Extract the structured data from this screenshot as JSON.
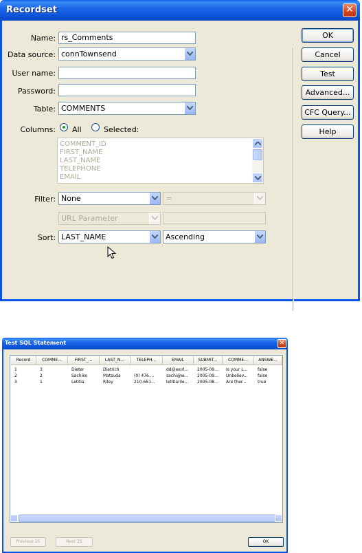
{
  "recordset": {
    "title": "Recordset",
    "fields": {
      "name_label": "Name:",
      "name_value": "rs_Comments",
      "datasource_label": "Data source:",
      "datasource_value": "connTownsend",
      "username_label": "User name:",
      "username_value": "",
      "password_label": "Password:",
      "password_value": "",
      "table_label": "Table:",
      "table_value": "COMMENTS",
      "columns_label": "Columns:",
      "columns_all": "All",
      "columns_selected": "Selected:",
      "columns_list": [
        "COMMENT_ID",
        "FIRST_NAME",
        "LAST_NAME",
        "TELEPHONE",
        "EMAIL"
      ],
      "filter_label": "Filter:",
      "filter_value": "None",
      "filter_operator": "=",
      "filter_param": "URL Parameter",
      "filter_param_value": "",
      "sort_label": "Sort:",
      "sort_value": "LAST_NAME",
      "sort_order": "Ascending"
    },
    "buttons": {
      "ok": "OK",
      "cancel": "Cancel",
      "test": "Test",
      "advanced": "Advanced...",
      "cfc_query": "CFC Query...",
      "help": "Help"
    }
  },
  "test_sql": {
    "title": "Test SQL Statement",
    "columns": [
      "Record",
      "COMME...",
      "FIRST_...",
      "LAST_N...",
      "TELEPH...",
      "EMAIL",
      "SUBMIT...",
      "COMME...",
      "ANSWE..."
    ],
    "rows": [
      [
        "1",
        "3",
        "Dieter",
        "Dietrich",
        "",
        "dd@worl...",
        "2005-09...",
        "Is your L...",
        "false"
      ],
      [
        "2",
        "2",
        "Sachiko",
        "Matsuda",
        "(0) 476 ...",
        "sachi@w...",
        "2005-09...",
        "Unbeliev...",
        "false"
      ],
      [
        "3",
        "1",
        "Letitia",
        "Riley",
        "210-651...",
        "letitiarile...",
        "2005-08...",
        "Are ther...",
        "true"
      ]
    ],
    "buttons": {
      "previous": "Previous 25",
      "next": "Next 25",
      "ok": "OK"
    }
  }
}
